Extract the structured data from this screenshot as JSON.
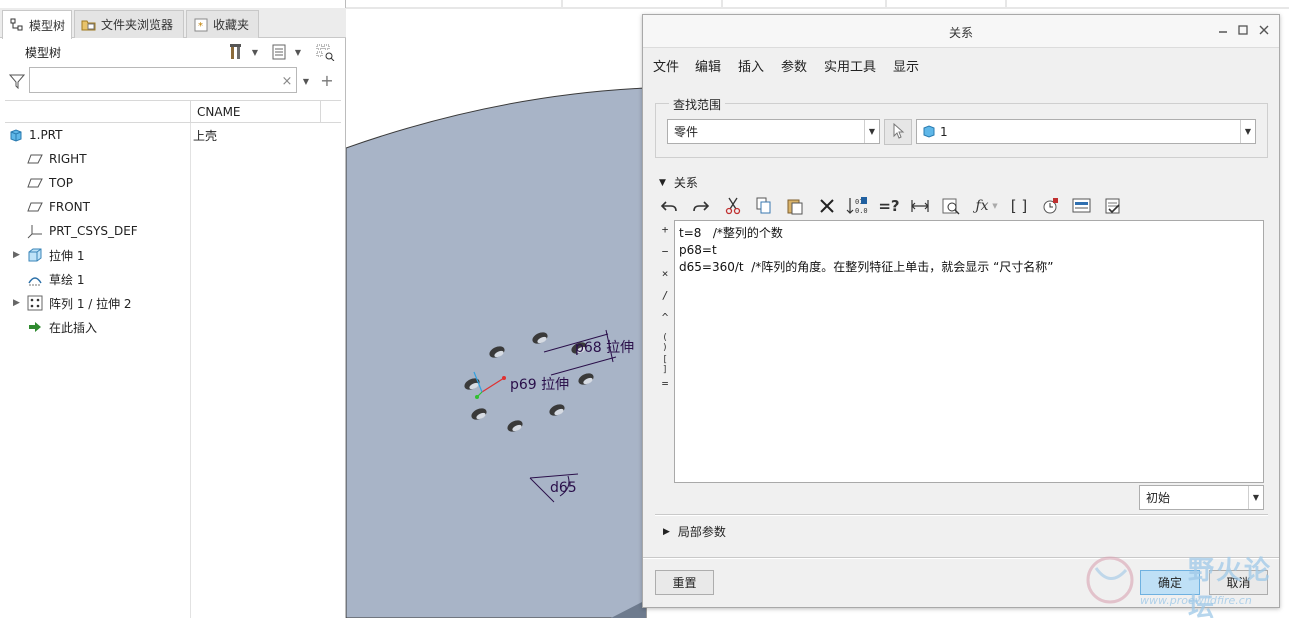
{
  "left_panel": {
    "tabs": [
      {
        "label": "模型树",
        "icon": "model-tree-icon"
      },
      {
        "label": "文件夹浏览器",
        "icon": "folder-browser-icon"
      },
      {
        "label": "收藏夹",
        "icon": "favorites-icon"
      }
    ],
    "tree_title": "模型树",
    "filter_placeholder": "",
    "clear_symbol": "×",
    "add_symbol": "+",
    "columns": {
      "col2": "CNAME"
    },
    "rows": [
      {
        "label": "1.PRT",
        "value": "上壳",
        "icon": "part-icon"
      },
      {
        "label": "RIGHT",
        "value": "",
        "icon": "datum-plane-icon"
      },
      {
        "label": "TOP",
        "value": "",
        "icon": "datum-plane-icon"
      },
      {
        "label": "FRONT",
        "value": "",
        "icon": "datum-plane-icon"
      },
      {
        "label": "PRT_CSYS_DEF",
        "value": "",
        "icon": "csys-icon"
      },
      {
        "label": "拉伸 1",
        "value": "",
        "icon": "extrude-icon"
      },
      {
        "label": "草绘 1",
        "value": "",
        "icon": "sketch-icon"
      },
      {
        "label": "阵列 1 / 拉伸 2",
        "value": "",
        "icon": "pattern-icon"
      },
      {
        "label": "在此插入",
        "value": "",
        "icon": "insert-here-arrow-icon"
      }
    ]
  },
  "canvas": {
    "annotations": {
      "p68": "p68 拉伸",
      "p69": "p69 拉伸",
      "d65": "d65"
    },
    "colors": {
      "part": "#a8b4c7",
      "outline": "#3a3a3a",
      "dim": "#2a0f4a"
    }
  },
  "dialog": {
    "title": "关系",
    "menu": [
      "文件",
      "编辑",
      "插入",
      "参数",
      "实用工具",
      "显示"
    ],
    "lookup": {
      "label": "查找范围",
      "type_value": "零件",
      "model_value": "1"
    },
    "relations": {
      "header": "关系",
      "operators": [
        "+",
        "−",
        "×",
        "/",
        "^",
        "( )",
        "[ ]",
        "="
      ],
      "lines": [
        "t=8   /*整列的个数",
        "p68=t",
        "d65=360/t  /*阵列的角度。在整列特征上单击，就会显示 “尺寸名称”"
      ],
      "units_value": "初始"
    },
    "local_params": "局部参数",
    "buttons": {
      "reset": "重置",
      "ok": "确定",
      "cancel": "取消"
    }
  },
  "watermark": {
    "text": "野火论坛",
    "url": "www.proewildfire.cn"
  }
}
